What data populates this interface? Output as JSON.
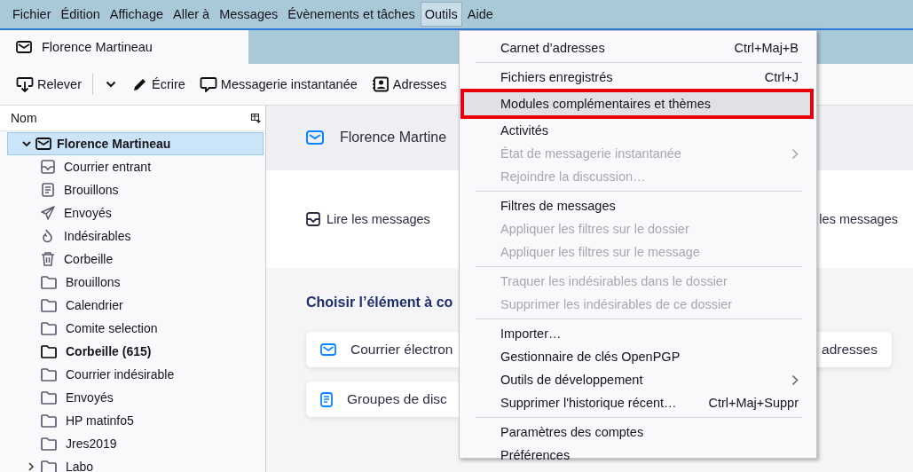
{
  "menubar": [
    {
      "label": "Fichier",
      "selected": false
    },
    {
      "label": "Édition",
      "selected": false
    },
    {
      "label": "Affichage",
      "selected": false
    },
    {
      "label": "Aller à",
      "selected": false
    },
    {
      "label": "Messages",
      "selected": false
    },
    {
      "label": "Évènements et tâches",
      "selected": false
    },
    {
      "label": "Outils",
      "selected": true
    },
    {
      "label": "Aide",
      "selected": false
    }
  ],
  "tabs": [
    {
      "label": "Florence Martineau",
      "selected": true
    }
  ],
  "toolbar": [
    {
      "kind": "get",
      "label": "Relever"
    },
    {
      "kind": "compose",
      "label": "Écrire"
    },
    {
      "kind": "chat",
      "label": "Messagerie instantanée"
    },
    {
      "kind": "contacts",
      "label": "Adresses"
    }
  ],
  "folder_pane": {
    "header": "Nom",
    "tree": [
      {
        "label": "Florence Martineau",
        "kind": "account",
        "expanded": true,
        "selected": true,
        "bold": true,
        "children": [
          {
            "label": "Courrier entrant",
            "kind": "inbox",
            "selected": false,
            "bold": false
          },
          {
            "label": "Brouillons",
            "kind": "drafts",
            "selected": false,
            "bold": false
          },
          {
            "label": "Envoyés",
            "kind": "sent",
            "selected": false,
            "bold": false
          },
          {
            "label": "Indésirables",
            "kind": "junk",
            "selected": false,
            "bold": false
          },
          {
            "label": "Corbeille",
            "kind": "trash",
            "selected": false,
            "bold": false
          },
          {
            "label": "Brouillons",
            "kind": "folder",
            "selected": false,
            "bold": false
          },
          {
            "label": "Calendrier",
            "kind": "folder",
            "selected": false,
            "bold": false
          },
          {
            "label": "Comite selection",
            "kind": "folder",
            "selected": false,
            "bold": false
          },
          {
            "label": "Corbeille (615)",
            "kind": "folder",
            "selected": false,
            "bold": true
          },
          {
            "label": "Courrier indésirable",
            "kind": "folder",
            "selected": false,
            "bold": false
          },
          {
            "label": "Envoyés",
            "kind": "folder",
            "selected": false,
            "bold": false
          },
          {
            "label": "HP matinfo5",
            "kind": "folder",
            "selected": false,
            "bold": false
          },
          {
            "label": "Jres2019",
            "kind": "folder",
            "selected": false,
            "bold": false
          },
          {
            "label": "Labo",
            "kind": "folder",
            "selected": false,
            "bold": false,
            "expanded": false
          }
        ]
      }
    ]
  },
  "account_page": {
    "title": "Florence Martine",
    "actions": [
      {
        "kind": "read",
        "label": "Lire les messages"
      },
      {
        "kind": "none",
        "label": "les messages"
      }
    ],
    "heading": "Choisir l’élément à co",
    "card_rows": [
      [
        {
          "kind": "mail",
          "label": "Courrier électron"
        },
        {
          "kind": "none",
          "label": "adresses"
        }
      ],
      [
        {
          "kind": "news",
          "label": "Groupes de disc"
        }
      ]
    ]
  },
  "tools_menu": [
    {
      "kind": "item",
      "label": "Carnet d’adresses",
      "shortcut": "Ctrl+Maj+B",
      "disabled": false,
      "submenu": false,
      "highlighted": false
    },
    {
      "kind": "separator"
    },
    {
      "kind": "item",
      "label": "Fichiers enregistrés",
      "shortcut": "Ctrl+J",
      "disabled": false,
      "submenu": false,
      "highlighted": false
    },
    {
      "kind": "item",
      "label": "Modules complémentaires et thèmes",
      "disabled": false,
      "submenu": false,
      "highlighted": true
    },
    {
      "kind": "item",
      "label": "Activités",
      "disabled": false,
      "submenu": false,
      "highlighted": false
    },
    {
      "kind": "item",
      "label": "État de messagerie instantanée",
      "disabled": true,
      "submenu": true,
      "highlighted": false
    },
    {
      "kind": "item",
      "label": "Rejoindre la discussion…",
      "disabled": true,
      "submenu": false,
      "highlighted": false
    },
    {
      "kind": "separator"
    },
    {
      "kind": "item",
      "label": "Filtres de messages",
      "disabled": false,
      "submenu": false,
      "highlighted": false
    },
    {
      "kind": "item",
      "label": "Appliquer les filtres sur le dossier",
      "disabled": true,
      "submenu": false,
      "highlighted": false
    },
    {
      "kind": "item",
      "label": "Appliquer les filtres sur le message",
      "disabled": true,
      "submenu": false,
      "highlighted": false
    },
    {
      "kind": "separator"
    },
    {
      "kind": "item",
      "label": "Traquer les indésirables dans le dossier",
      "disabled": true,
      "submenu": false,
      "highlighted": false
    },
    {
      "kind": "item",
      "label": "Supprimer les indésirables de ce dossier",
      "disabled": true,
      "submenu": false,
      "highlighted": false
    },
    {
      "kind": "separator"
    },
    {
      "kind": "item",
      "label": "Importer…",
      "disabled": false,
      "submenu": false,
      "highlighted": false
    },
    {
      "kind": "item",
      "label": "Gestionnaire de clés OpenPGP",
      "disabled": false,
      "submenu": false,
      "highlighted": false
    },
    {
      "kind": "item",
      "label": "Outils de développement",
      "disabled": false,
      "submenu": true,
      "highlighted": false
    },
    {
      "kind": "item",
      "label": "Supprimer l'historique récent…",
      "shortcut": "Ctrl+Maj+Suppr",
      "disabled": false,
      "submenu": false,
      "highlighted": false
    },
    {
      "kind": "separator"
    },
    {
      "kind": "item",
      "label": "Paramètres des comptes",
      "disabled": false,
      "submenu": false,
      "highlighted": false
    },
    {
      "kind": "item",
      "label": "Préférences",
      "disabled": false,
      "submenu": false,
      "highlighted": false
    }
  ]
}
